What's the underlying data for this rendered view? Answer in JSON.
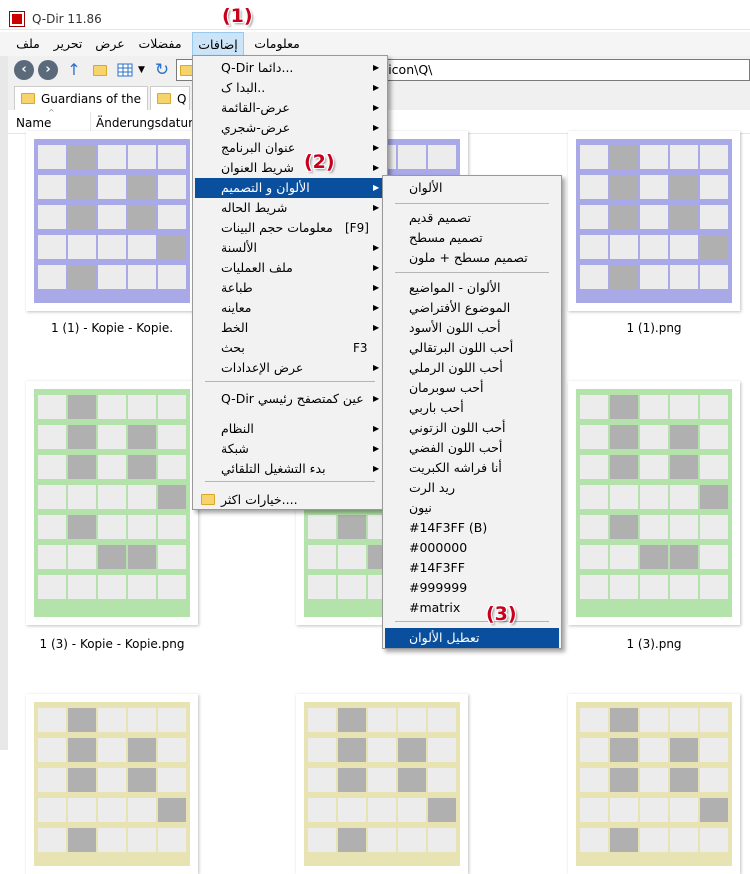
{
  "window": {
    "title": "Q-Dir 11.86"
  },
  "menubar": {
    "items": [
      {
        "label": "ملف",
        "key": "file"
      },
      {
        "label": "تحرير",
        "key": "edit"
      },
      {
        "label": "عرض",
        "key": "view"
      },
      {
        "label": "مفضلات",
        "key": "favorites"
      },
      {
        "label": "إضافات",
        "key": "extras"
      },
      {
        "label": "معلومات",
        "key": "info"
      }
    ]
  },
  "address": {
    "path": "\\icon\\Q\\"
  },
  "tabs": [
    {
      "label": "Guardians of the ..."
    },
    {
      "label": "Q"
    }
  ],
  "columns": {
    "name": "Name",
    "date": "Änderungsdatum"
  },
  "files": [
    {
      "caption": "1 (1) - Kopie - Kopie.",
      "color": "#a9a9e8"
    },
    {
      "caption": "",
      "color": "#a9a9e8"
    },
    {
      "caption": "1 (1).png",
      "color": "#a9a9e8"
    },
    {
      "caption": "1 (3) - Kopie - Kopie.png",
      "color": "#b3e3aa"
    },
    {
      "caption": "",
      "color": "#b3e3aa"
    },
    {
      "caption": "1 (3).png",
      "color": "#b3e3aa"
    },
    {
      "caption": "",
      "color": "#e8e3b3"
    },
    {
      "caption": "",
      "color": "#e8e3b3"
    },
    {
      "caption": "",
      "color": "#e8e3b3"
    }
  ],
  "extras_menu": {
    "items": [
      {
        "label": "Q-Dir دائما..."
      },
      {
        "label": "البدا ک.."
      },
      {
        "label": "عرض-القائمة"
      },
      {
        "label": "عرض-شجري"
      },
      {
        "label": "عنوان البرنامج"
      },
      {
        "label": "شريط العنوان"
      },
      {
        "label": "الألوان و التصميم"
      },
      {
        "label": "شريط الحاله"
      },
      {
        "label": "معلومات حجم البينات",
        "shortcut": "[F9]"
      },
      {
        "label": "الألسنة"
      },
      {
        "label": "ملف العمليات"
      },
      {
        "label": "طباعة"
      },
      {
        "label": "معاينه"
      },
      {
        "label": "الخط"
      },
      {
        "label": "بحث",
        "shortcut": "F3"
      },
      {
        "label": "عرض الإعدادات"
      },
      {
        "label": "Q-Dir عين كمتصفح رئيسي"
      },
      {
        "label": "النظام"
      },
      {
        "label": "شبكة"
      },
      {
        "label": "بدء التشغيل التلقائي"
      },
      {
        "label": "خيارات اكثر...."
      }
    ]
  },
  "colors_menu": {
    "items": [
      {
        "label": "الألوان"
      },
      {
        "label": "تصميم قديم"
      },
      {
        "label": "تصميم مسطح"
      },
      {
        "label": "تصميم مسطح + ملون"
      },
      {
        "label": "الألوان - المواضيع"
      },
      {
        "label": "الموضوع الأفتراضي"
      },
      {
        "label": "أحب اللون الأسود"
      },
      {
        "label": "أحب اللون البرتقالي"
      },
      {
        "label": "أحب اللون الرملي"
      },
      {
        "label": "أحب سوبرمان"
      },
      {
        "label": "أحب باربي"
      },
      {
        "label": "أحب اللون الزتوني"
      },
      {
        "label": "أحب اللون الفضي"
      },
      {
        "label": "أنا فراشه الكبريت"
      },
      {
        "label": "ريد الرت"
      },
      {
        "label": "نيون"
      },
      {
        "label": "#14F3FF (B)"
      },
      {
        "label": "#000000"
      },
      {
        "label": "#14F3FF"
      },
      {
        "label": "#999999"
      },
      {
        "label": "#matrix"
      },
      {
        "label": "تعطيل الألوان"
      }
    ]
  },
  "annotations": [
    "(1)",
    "(2)",
    "(3)"
  ],
  "colors": {
    "highlight": "#0a4f9e",
    "badge": "#c8001e",
    "menu_bg": "#f2f2f2"
  }
}
